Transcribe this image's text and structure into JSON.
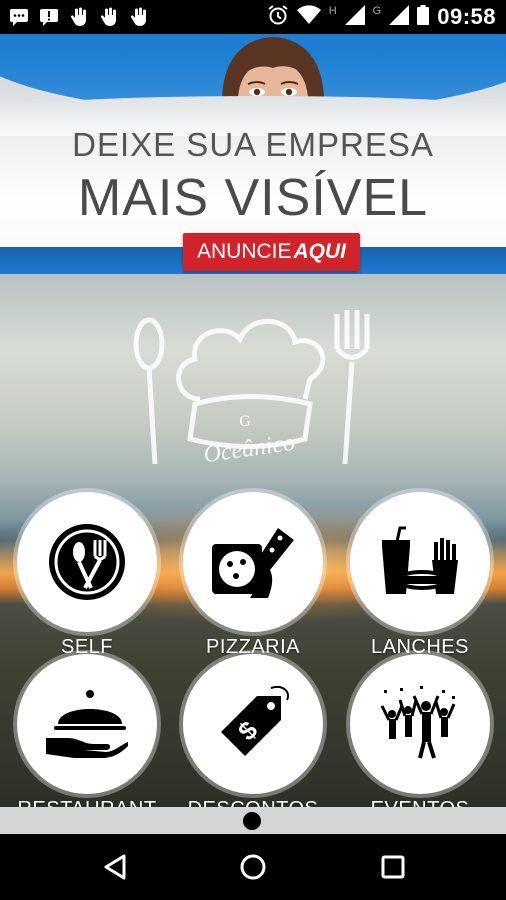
{
  "status_bar": {
    "time": "09:58",
    "signal_h_label": "H",
    "signal_g_label": "G",
    "left_icons": [
      "message-icon",
      "alert-icon",
      "hand-icon",
      "hand-icon",
      "hand-icon"
    ],
    "right_icons": [
      "alarm-icon",
      "wifi-icon",
      "signal-icon",
      "signal-icon",
      "battery-icon"
    ]
  },
  "banner": {
    "line1": "DEIXE SUA EMPRESA",
    "line2": "MAIS VISÍVEL",
    "cta_prefix": "ANUNCIE",
    "cta_emphasis": "AQUI"
  },
  "logo": {
    "text": "Oceânico",
    "monogram": "G"
  },
  "categories": [
    {
      "label": "SELF",
      "icon": "plate-cutlery-icon"
    },
    {
      "label": "PIZZARIA",
      "icon": "pizza-icon"
    },
    {
      "label": "LANCHES",
      "icon": "fast-food-icon"
    },
    {
      "label": "RESTAURANT",
      "icon": "cloche-icon"
    },
    {
      "label": "DESCONTOS",
      "icon": "price-tag-icon"
    },
    {
      "label": "EVENTOS",
      "icon": "party-crowd-icon"
    }
  ],
  "navigation": {
    "back_icon": "back-icon",
    "home_icon": "home-icon",
    "recents_icon": "recents-icon"
  },
  "colors": {
    "banner_blue": "#1d7fd3",
    "cta_red": "#d2232a",
    "tile_bg": "#ffffff",
    "label_text": "#ffffff"
  }
}
